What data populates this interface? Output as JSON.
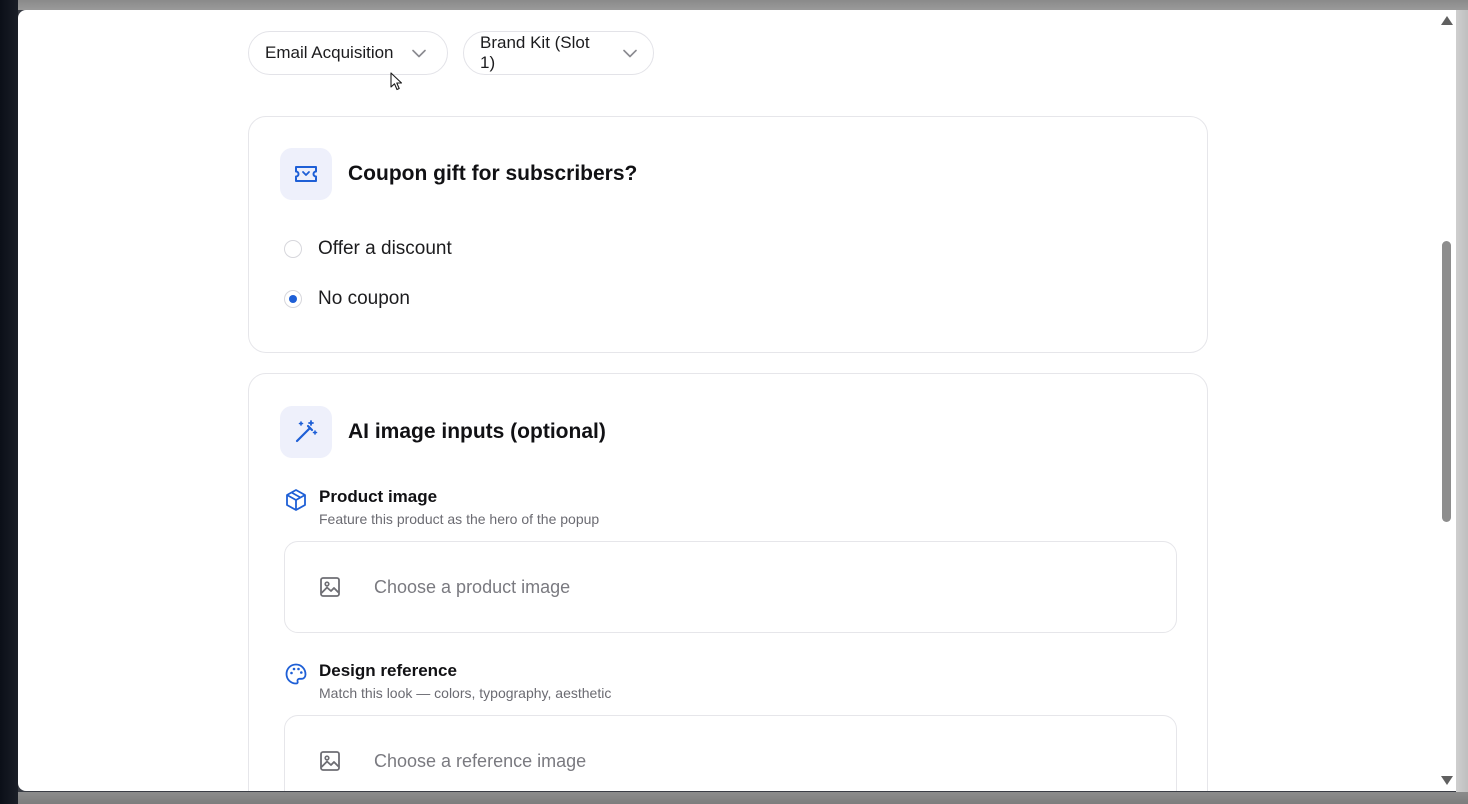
{
  "toolbar": {
    "goal_dropdown": "Email Acquisition",
    "brand_dropdown": "Brand Kit (Slot 1)"
  },
  "coupon_card": {
    "title": "Coupon gift for subscribers?",
    "icon": "ticket-icon",
    "options": [
      {
        "label": "Offer a discount",
        "checked": false
      },
      {
        "label": "No coupon",
        "checked": true
      }
    ]
  },
  "ai_card": {
    "title": "AI image inputs (optional)",
    "icon": "magic-wand-icon",
    "product": {
      "title": "Product image",
      "subtitle": "Feature this product as the hero of the popup",
      "picker_label": "Choose a product image",
      "icon": "box-icon"
    },
    "design": {
      "title": "Design reference",
      "subtitle": "Match this look — colors, typography, aesthetic",
      "picker_label": "Choose a reference image",
      "icon": "palette-icon"
    }
  },
  "colors": {
    "accent": "#1e5fd6",
    "icon_tile_bg": "#eef0fb"
  }
}
